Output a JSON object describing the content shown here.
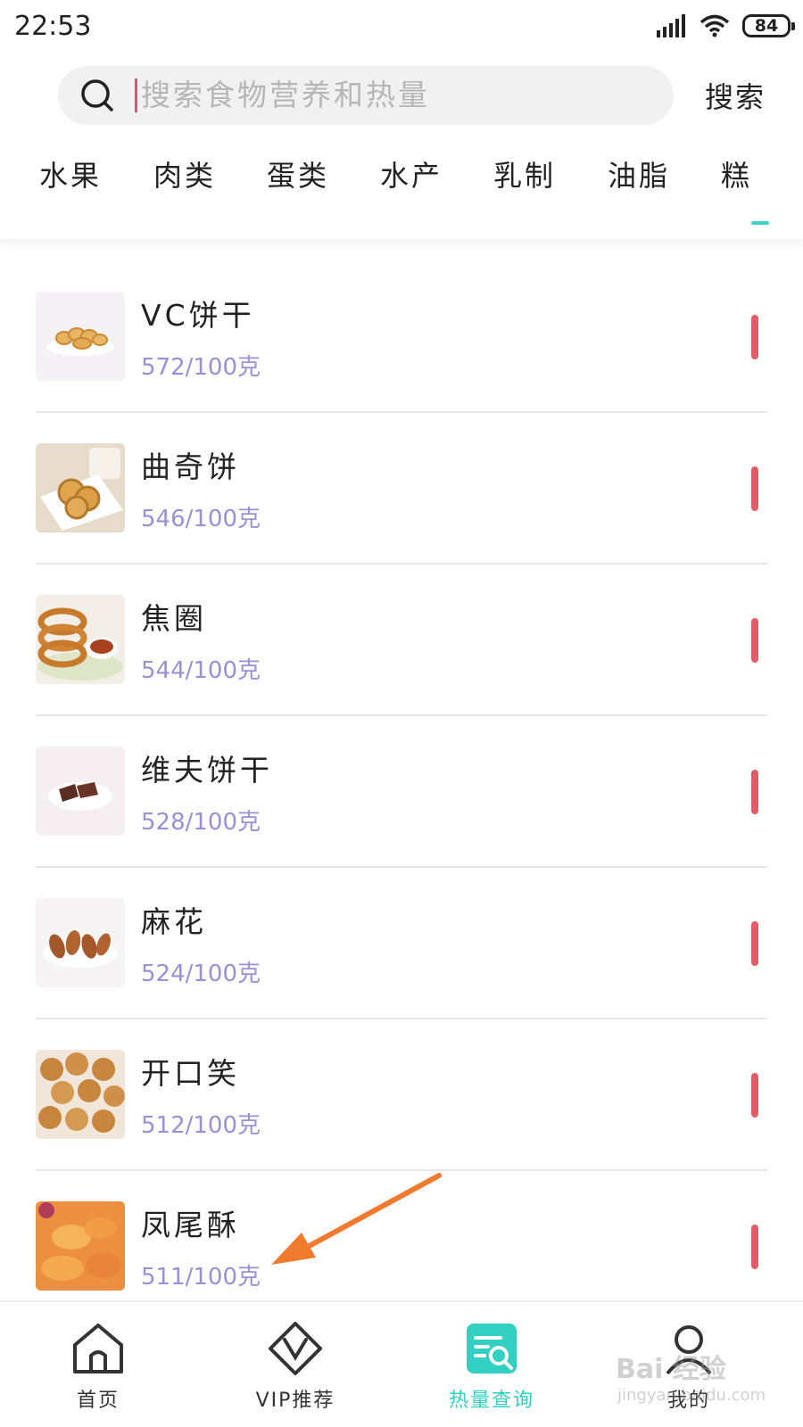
{
  "status_bar": {
    "time": "22:53",
    "battery": "84"
  },
  "search": {
    "placeholder": "搜索食物营养和热量",
    "button_label": "搜索"
  },
  "tabs": [
    {
      "label": "水果"
    },
    {
      "label": "肉类"
    },
    {
      "label": "蛋类"
    },
    {
      "label": "水产"
    },
    {
      "label": "乳制"
    },
    {
      "label": "油脂"
    },
    {
      "label": "糕"
    }
  ],
  "foods": [
    {
      "name": "VC饼干",
      "calories": "572/100克"
    },
    {
      "name": "曲奇饼",
      "calories": "546/100克"
    },
    {
      "name": "焦圈",
      "calories": "544/100克"
    },
    {
      "name": "维夫饼干",
      "calories": "528/100克"
    },
    {
      "name": "麻花",
      "calories": "524/100克"
    },
    {
      "name": "开口笑",
      "calories": "512/100克"
    },
    {
      "name": "凤尾酥",
      "calories": "511/100克"
    }
  ],
  "bottom_nav": [
    {
      "label": "首页",
      "icon": "home-icon"
    },
    {
      "label": "VIP推荐",
      "icon": "vip-icon"
    },
    {
      "label": "热量查询",
      "icon": "calorie-search-icon",
      "active": true
    },
    {
      "label": "我的",
      "icon": "profile-icon"
    }
  ],
  "watermark": {
    "brand": "Bai 经验",
    "url": "jingyan.baidu.com"
  },
  "colors": {
    "accent": "#32cfc3",
    "calorie_text": "#9c8fd6",
    "calorie_bar": "#e05c66",
    "caret": "#e0507b",
    "arrow": "#f07a2e"
  }
}
